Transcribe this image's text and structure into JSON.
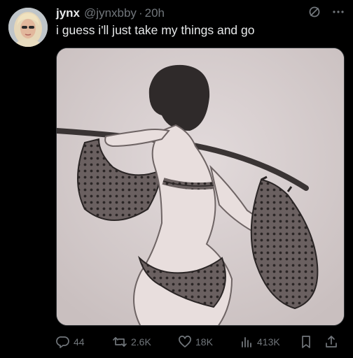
{
  "tweet": {
    "display_name": "jynx",
    "handle": "@jynxbby",
    "separator": "·",
    "timestamp": "20h",
    "text": "i guess i'll just take my things and go",
    "header_icons": [
      "grok-icon",
      "more-options-icon"
    ],
    "media_icon": "sketch-image"
  },
  "actions": {
    "replies": "44",
    "reposts": "2.6K",
    "likes": "18K",
    "views": "413K"
  },
  "colors": {
    "background": "#000000",
    "text_primary": "#e7e9ea",
    "text_secondary": "#71767b"
  }
}
